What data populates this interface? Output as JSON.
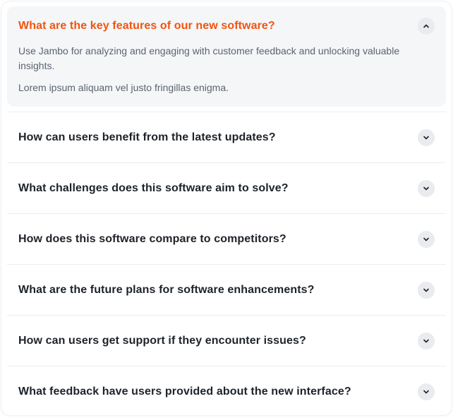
{
  "faq": {
    "items": [
      {
        "question": "What are the key features of our new software?",
        "expanded": true,
        "answer": [
          "Use Jambo for analyzing and engaging with customer feedback and unlocking valuable insights.",
          "Lorem ipsum aliquam vel justo fringillas enigma."
        ],
        "icon": "chevron-up-icon"
      },
      {
        "question": "How can users benefit from the latest updates?",
        "expanded": false,
        "icon": "chevron-down-icon"
      },
      {
        "question": "What challenges does this software aim to solve?",
        "expanded": false,
        "icon": "chevron-down-icon"
      },
      {
        "question": "How does this software compare to competitors?",
        "expanded": false,
        "icon": "chevron-down-icon"
      },
      {
        "question": "What are the future plans for software enhancements?",
        "expanded": false,
        "icon": "chevron-down-icon"
      },
      {
        "question": "How can users get support if they encounter issues?",
        "expanded": false,
        "icon": "chevron-down-icon"
      },
      {
        "question": "What feedback have users provided about the new interface?",
        "expanded": false,
        "icon": "chevron-down-icon"
      }
    ]
  },
  "colors": {
    "accent": "#f2540e",
    "question_text": "#1e2329",
    "answer_text": "#5b6470",
    "open_background": "#f5f6f8",
    "icon_background": "#e9ebee"
  }
}
